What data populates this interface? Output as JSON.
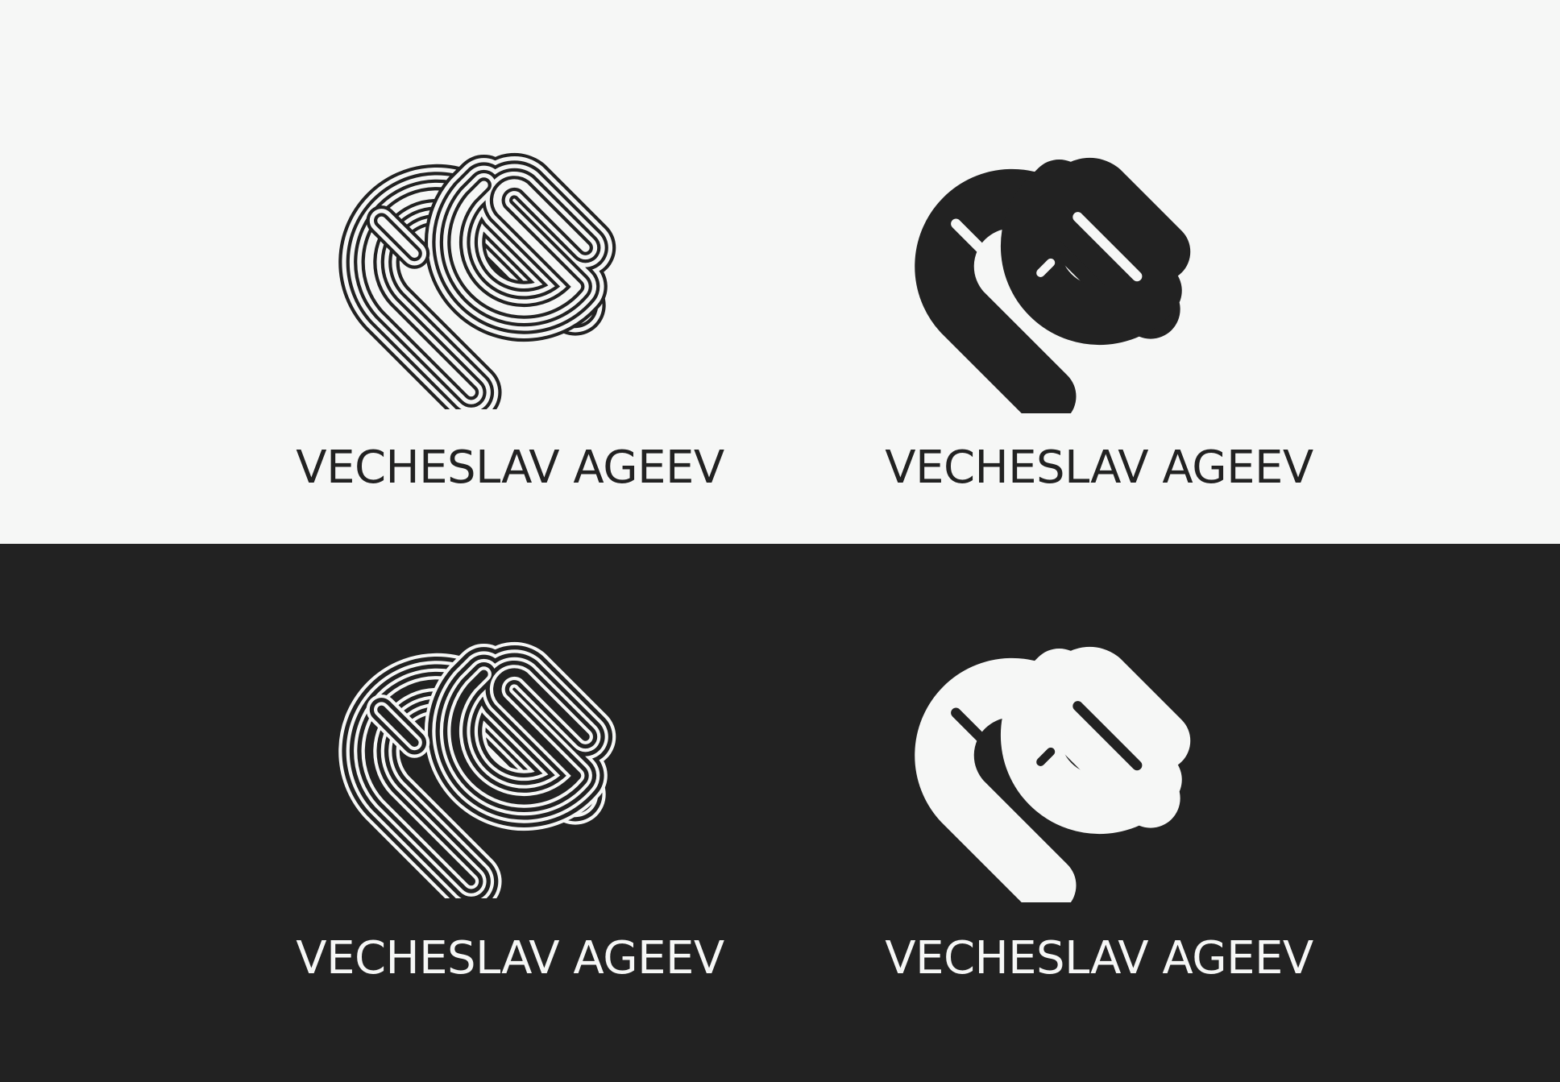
{
  "colors": {
    "light_background": "#f6f7f6",
    "dark_background": "#222222",
    "ink_dark": "#222222",
    "ink_light": "#f6f7f6"
  },
  "logos": [
    {
      "variant": "outline",
      "theme": "light",
      "wordmark": "VECHESLAV AGEEV"
    },
    {
      "variant": "solid",
      "theme": "light",
      "wordmark": "VECHESLAV AGEEV"
    },
    {
      "variant": "outline",
      "theme": "dark",
      "wordmark": "VECHESLAV AGEEV"
    },
    {
      "variant": "solid",
      "theme": "dark",
      "wordmark": "VECHESLAV AGEEV"
    }
  ]
}
